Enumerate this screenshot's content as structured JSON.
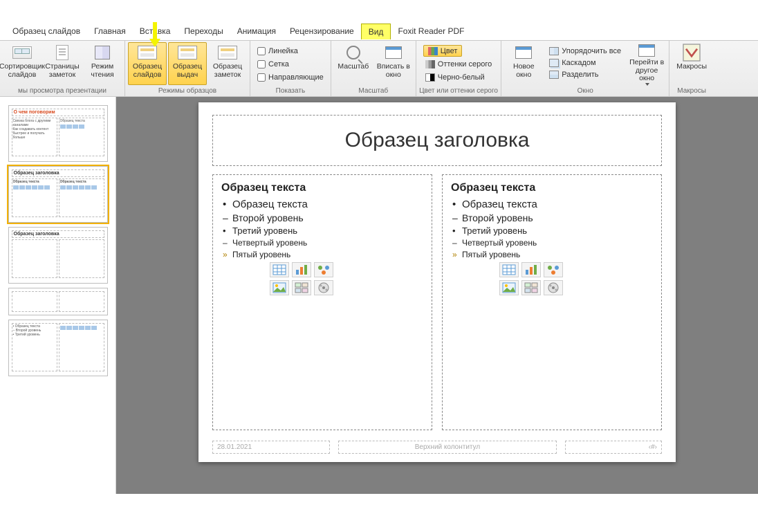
{
  "tabs": {
    "slide_master": "Образец слайдов",
    "home": "Главная",
    "insert": "Вставка",
    "transitions": "Переходы",
    "animation": "Анимация",
    "review": "Рецензирование",
    "view": "Вид",
    "foxit": "Foxit Reader PDF"
  },
  "ribbon": {
    "group_presentation_views": {
      "label": "мы просмотра презентации",
      "sorter": "Сортировщик слайдов",
      "notes_page": "Страницы заметок",
      "reading": "Режим чтения"
    },
    "group_master_views": {
      "label": "Режимы образцов",
      "slide_master": "Образец слайдов",
      "handout_master": "Образец выдач",
      "notes_master": "Образец заметок"
    },
    "group_show": {
      "label": "Показать",
      "ruler": "Линейка",
      "gridlines": "Сетка",
      "guides": "Направляющие"
    },
    "group_zoom": {
      "label": "Масштаб",
      "zoom": "Масштаб",
      "fit": "Вписать в окно"
    },
    "group_color": {
      "label": "Цвет или оттенки серого",
      "color": "Цвет",
      "grayscale": "Оттенки серого",
      "bw": "Черно-белый"
    },
    "group_window": {
      "label": "Окно",
      "new_window": "Новое окно",
      "arrange_all": "Упорядочить все",
      "cascade": "Каскадом",
      "split": "Разделить",
      "switch": "Перейти в другое окно"
    },
    "group_macros": {
      "label": "Макросы",
      "macros": "Макросы"
    }
  },
  "thumbs": {
    "t1_title": "О чем поговорим",
    "t1_sub1": "Связка блога с другими каналами",
    "t1_sub2": "Как создавать контент быстрее и получать больше",
    "t2_title": "Образец заголовка",
    "t2_col": "Образец текста",
    "t3_title": "Образец заголовка",
    "t5_col": "• Образец текста\n  – Второй уровень\n    • Третий уровень"
  },
  "slide": {
    "title": "Образец заголовка",
    "subtitle": "Образец текста",
    "bullet1": "Образец текста",
    "bullet2": "Второй уровень",
    "bullet3": "Третий уровень",
    "bullet4": "Четвертый уровень",
    "bullet5": "Пятый уровень",
    "footer_date": "28.01.2021",
    "footer_center": "Верхний колонтитул",
    "footer_num": "‹#›"
  }
}
